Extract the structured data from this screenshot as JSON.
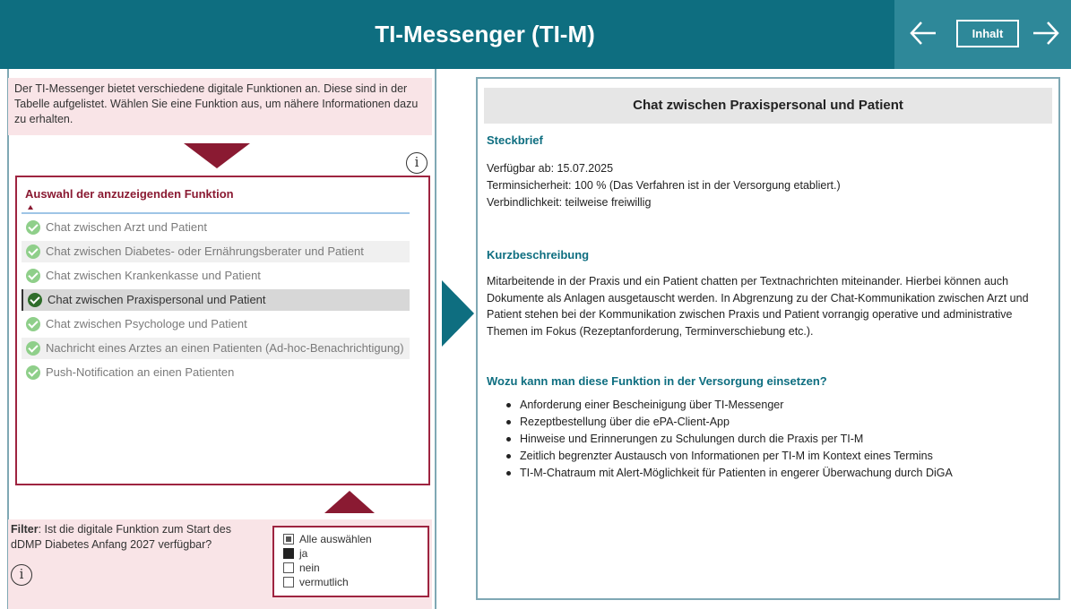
{
  "header": {
    "title": "TI-Messenger (TI-M)",
    "inhalt_label": "Inhalt"
  },
  "intro_text": "Der TI-Messenger bietet verschiedene digitale Funktionen an. Diese sind in der Tabelle aufgelistet. Wählen Sie eine Funktion aus, um nähere Informationen dazu zu erhalten.",
  "icons": {
    "back": "arrow-left-icon",
    "forward": "arrow-right-icon",
    "info": "info-icon",
    "check": "check-circle-icon",
    "scroll_up": "triangle-down-icon",
    "scroll_down": "triangle-up-icon",
    "pointer": "triangle-right-icon",
    "info_glyph": "i"
  },
  "function_list": {
    "title": "Auswahl der anzuzeigenden Funktion",
    "items": [
      {
        "label": "Chat zwischen Arzt und Patient",
        "selected": false
      },
      {
        "label": "Chat zwischen Diabetes- oder Ernährungsberater und Patient",
        "selected": false
      },
      {
        "label": "Chat zwischen Krankenkasse und Patient",
        "selected": false
      },
      {
        "label": "Chat zwischen Praxispersonal und Patient",
        "selected": true
      },
      {
        "label": "Chat zwischen Psychologe und Patient",
        "selected": false
      },
      {
        "label": "Nachricht eines Arztes an einen Patienten (Ad-hoc-Benachrichtigung)",
        "selected": false
      },
      {
        "label": "Push-Notification an einen Patienten",
        "selected": false
      }
    ]
  },
  "filter": {
    "label": "Filter",
    "question": ": Ist die digitale Funktion zum Start des dDMP Diabetes Anfang 2027 verfügbar?",
    "options": [
      {
        "label": "Alle auswählen",
        "state": "partial"
      },
      {
        "label": "ja",
        "state": "checked"
      },
      {
        "label": "nein",
        "state": "unchecked"
      },
      {
        "label": "vermutlich",
        "state": "unchecked"
      }
    ]
  },
  "detail": {
    "title": "Chat zwischen Praxispersonal und Patient",
    "steckbrief_heading": "Steckbrief",
    "verfuegbar": "Verfügbar ab: 15.07.2025",
    "terminsicherheit": "Terminsicherheit: 100 % (Das Verfahren ist in der Versorgung etabliert.)",
    "verbindlichkeit": "Verbindlichkeit: teilweise freiwillig",
    "kurz_heading": "Kurzbeschreibung",
    "kurz_text": "Mitarbeitende in der Praxis und ein Patient chatten per Textnachrichten miteinander. Hierbei können auch Dokumente als Anlagen ausgetauscht werden. In Abgrenzung zu der Chat-Kommunikation zwischen Arzt und Patient stehen bei der Kommunikation zwischen Praxis und Patient vorrangig operative und administrative Themen im Fokus (Rezeptanforderung, Terminverschiebung etc.).",
    "usage_heading": "Wozu kann man diese Funktion in der Versorgung einsetzen?",
    "usage_items": [
      "Anforderung einer Bescheinigung über TI-Messenger",
      "Rezeptbestellung über die ePA-Client-App",
      "Hinweise und Erinnerungen zu Schulungen durch die Praxis per TI-M",
      "Zeitlich begrenzter Austausch von Informationen per TI-M im Kontext eines Termins",
      "TI-M-Chatraum mit Alert-Möglichkeit für Patienten in engerer Überwachung durch DiGA"
    ]
  },
  "colors": {
    "header_teal": "#0e6e80",
    "nav_teal": "#2e8899",
    "accent_red": "#8a1a32",
    "pink_bg": "#f9e4e7",
    "check_green": "#8fcf8a"
  }
}
